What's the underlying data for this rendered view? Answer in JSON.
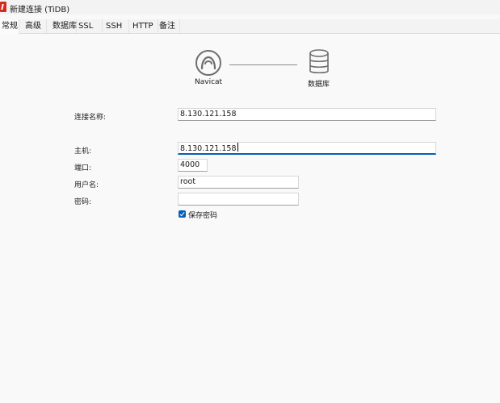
{
  "window": {
    "title": "新建连接 (TiDB)",
    "app_icon": "navicat-app-icon"
  },
  "tabs": [
    {
      "label": "常规",
      "active": true
    },
    {
      "label": "高级",
      "active": false
    },
    {
      "label": "数据库",
      "active": false
    },
    {
      "label": "SSL",
      "active": false
    },
    {
      "label": "SSH",
      "active": false
    },
    {
      "label": "HTTP",
      "active": false
    },
    {
      "label": "备注",
      "active": false
    }
  ],
  "diagram": {
    "client_label": "Navicat",
    "client_icon": "navicat-icon",
    "server_label": "数据库",
    "server_icon": "database-icon"
  },
  "form": {
    "connection_name": {
      "label": "连接名称:",
      "value": "8.130.121.158"
    },
    "host": {
      "label": "主机:",
      "value": "8.130.121.158"
    },
    "port": {
      "label": "端口:",
      "value": "4000"
    },
    "username": {
      "label": "用户名:",
      "value": "root"
    },
    "password": {
      "label": "密码:",
      "value": ""
    },
    "save_password": {
      "label": "保存密码",
      "checked": true
    }
  },
  "colors": {
    "accent": "#005fb8",
    "brand": "#d42a1f"
  }
}
